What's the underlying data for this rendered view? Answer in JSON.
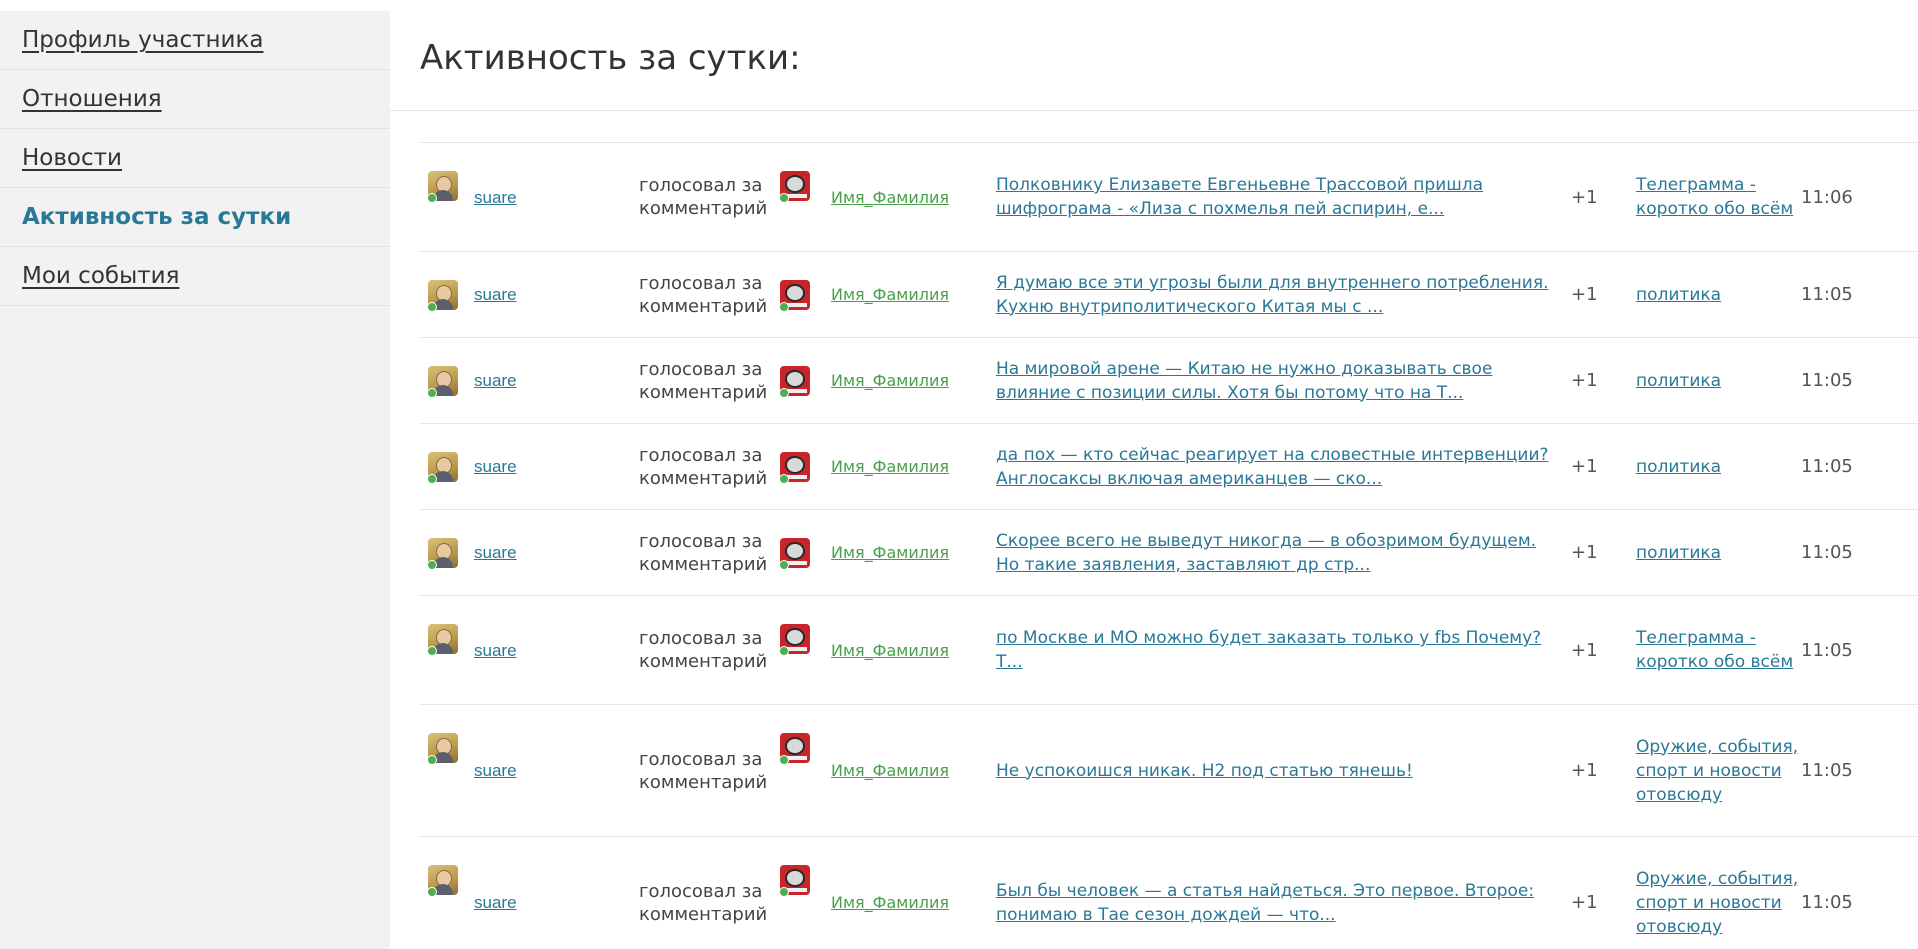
{
  "sidebar": {
    "items": [
      {
        "label": "Профиль участника",
        "active": false
      },
      {
        "label": "Отношения",
        "active": false
      },
      {
        "label": "Новости",
        "active": false
      },
      {
        "label": "Активность за сутки",
        "active": true
      },
      {
        "label": "Мои события",
        "active": false
      }
    ]
  },
  "main": {
    "title": "Активность за сутки:"
  },
  "colors": {
    "accent": "#2a7898",
    "target_name": "#4aa04a",
    "online": "#4caf50",
    "sidebar_bg": "#f2f2f2"
  },
  "icons": {
    "user_avatar": "user-avatar-icon",
    "target_avatar": "target-avatar-icon",
    "online": "online-status-icon"
  },
  "rows": [
    {
      "user": "suare",
      "action": "голосовал за комментарий",
      "target": "Имя_Фамилия",
      "comment": "Полковнику Елизавете Евгеньевне Трассовой пришла шифрограма -  «Лиза с  похмелья пей аспирин, е...",
      "score": "+1",
      "blog": "Телеграмма - коротко обо всём",
      "time": "11:06"
    },
    {
      "user": "suare",
      "action": "голосовал за комментарий",
      "target": "Имя_Фамилия",
      "comment": "Я думаю все эти  угрозы были  для внутреннего потребления. Кухню внутриполитического  Китая мы с ...",
      "score": "+1",
      "blog": "политика",
      "time": "11:05"
    },
    {
      "user": "suare",
      "action": "голосовал за комментарий",
      "target": "Имя_Фамилия",
      "comment": "На мировой арене — Китаю не нужно доказывать свое влияние с позиции силы. Хотя бы потому что на Т...",
      "score": "+1",
      "blog": "политика",
      "time": "11:05"
    },
    {
      "user": "suare",
      "action": "голосовал за комментарий",
      "target": "Имя_Фамилия",
      "comment": "да пох — кто сейчас  реагирует  на словестные интервенции?  Англосаксы включая американцев — ско...",
      "score": "+1",
      "blog": "политика",
      "time": "11:05"
    },
    {
      "user": "suare",
      "action": "голосовал за комментарий",
      "target": "Имя_Фамилия",
      "comment": "Скорее всего  не выведут  никогда — в обозримом будущем.  Но такие заявления, заставляют  др стр...",
      "score": "+1",
      "blog": "политика",
      "time": "11:05"
    },
    {
      "user": "suare",
      "action": "голосовал за комментарий",
      "target": "Имя_Фамилия",
      "comment": "по Москве и МО можно будет заказать только у fbs Почему? Т...",
      "score": "+1",
      "blog": "Телеграмма - коротко обо всём",
      "time": "11:05"
    },
    {
      "user": "suare",
      "action": "голосовал за комментарий",
      "target": "Имя_Фамилия",
      "comment": "Не успокоишся никак. Н2 под статью  тянешь!",
      "score": "+1",
      "blog": "Оружие, события, спорт и новости отовсюду",
      "time": "11:05"
    },
    {
      "user": "suare",
      "action": "голосовал за комментарий",
      "target": "Имя_Фамилия",
      "comment": "Был бы человек — а статья найдеться. Это первое.  Второе: понимаю в Тае сезон дождей — что...",
      "score": "+1",
      "blog": "Оружие, события, спорт и новости отовсюду",
      "time": "11:05"
    }
  ]
}
